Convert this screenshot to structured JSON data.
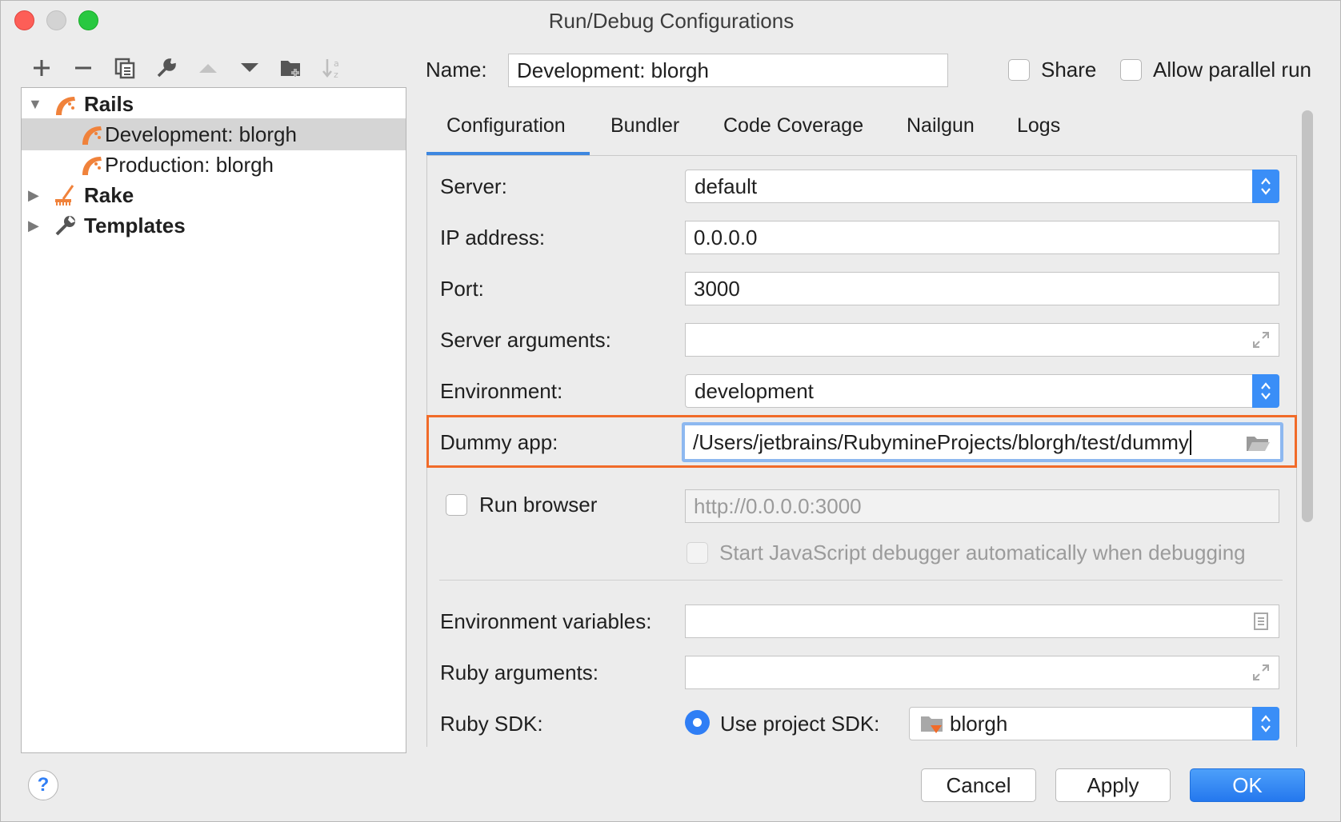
{
  "window": {
    "title": "Run/Debug Configurations"
  },
  "toolbar": {
    "icons": [
      "add-icon",
      "remove-icon",
      "copy-icon",
      "wrench-icon",
      "move-up-icon",
      "move-down-icon",
      "new-folder-icon",
      "sort-icon"
    ]
  },
  "tree": {
    "items": [
      {
        "label": "Rails",
        "icon": "rails-icon",
        "bold": true
      },
      {
        "label": "Development: blorgh",
        "icon": "rails-config-icon",
        "selected": true
      },
      {
        "label": "Production: blorgh",
        "icon": "rails-config-icon"
      },
      {
        "label": "Rake",
        "icon": "rake-icon",
        "bold": true
      },
      {
        "label": "Templates",
        "icon": "wrench-icon",
        "bold": true
      }
    ]
  },
  "header": {
    "name_label": "Name:",
    "name_value": "Development: blorgh",
    "share_label": "Share",
    "parallel_label": "Allow parallel run"
  },
  "tabs": [
    {
      "label": "Configuration",
      "active": true
    },
    {
      "label": "Bundler"
    },
    {
      "label": "Code Coverage"
    },
    {
      "label": "Nailgun"
    },
    {
      "label": "Logs"
    }
  ],
  "form": {
    "server_label": "Server:",
    "server_value": "default",
    "ip_label": "IP address:",
    "ip_value": "0.0.0.0",
    "port_label": "Port:",
    "port_value": "3000",
    "server_args_label": "Server arguments:",
    "server_args_value": "",
    "environment_label": "Environment:",
    "environment_value": "development",
    "dummy_label": "Dummy app:",
    "dummy_value": "/Users/jetbrains/RubymineProjects/blorgh/test/dummy",
    "run_browser_label": "Run browser",
    "run_browser_url": "http://0.0.0.0:3000",
    "js_debugger_label": "Start JavaScript debugger automatically when debugging",
    "env_vars_label": "Environment variables:",
    "env_vars_value": "",
    "ruby_args_label": "Ruby arguments:",
    "ruby_args_value": "",
    "ruby_sdk_label": "Ruby SDK:",
    "use_project_sdk_label": "Use project SDK:",
    "sdk_value": "blorgh"
  },
  "footer": {
    "help_label": "?",
    "cancel_label": "Cancel",
    "apply_label": "Apply",
    "ok_label": "OK"
  },
  "colors": {
    "accent": "#2f7ef5",
    "highlight": "#f16b29",
    "rails": "#f0823b"
  }
}
